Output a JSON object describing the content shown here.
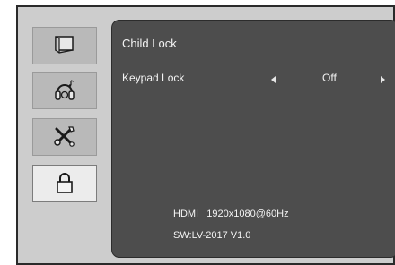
{
  "sidebar": {
    "items": [
      {
        "id": "picture",
        "icon": "monitor-icon",
        "active": false
      },
      {
        "id": "audio",
        "icon": "headphones-icon",
        "active": false
      },
      {
        "id": "setup",
        "icon": "tools-icon",
        "active": false
      },
      {
        "id": "child-lock",
        "icon": "lock-icon",
        "active": true
      }
    ]
  },
  "panel": {
    "title": "Child Lock",
    "settings": [
      {
        "label": "Keypad Lock",
        "value": "Off"
      }
    ]
  },
  "info": {
    "signal": "HDMI   1920x1080@60Hz",
    "version": "SW:LV-2017 V1.0"
  },
  "colors": {
    "osd_background": "#cdcdcd",
    "panel_background": "#4d4d4d",
    "active_tab": "#ececec",
    "inactive_tab": "#b9b9b9"
  }
}
